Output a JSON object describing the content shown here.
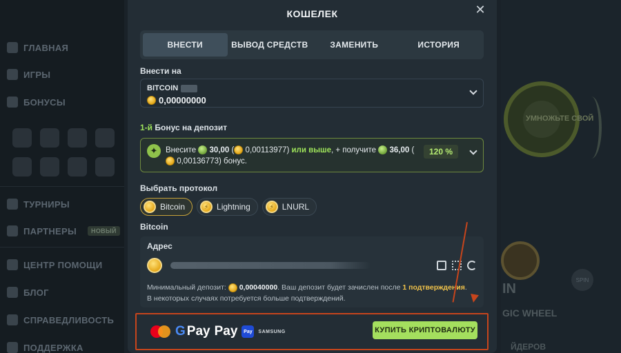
{
  "background_sidebar": {
    "items": [
      {
        "label": "ГЛАВНАЯ",
        "icon": "home-icon"
      },
      {
        "label": "ИГРЫ",
        "icon": "gamepad-icon"
      },
      {
        "label": "БОНУСЫ",
        "icon": "gift-icon"
      },
      {
        "label": "ТУРНИРЫ",
        "icon": "trophy-icon"
      },
      {
        "label": "ПАРТНЕРЫ",
        "icon": "partners-icon",
        "badge": "НОВЫЙ"
      },
      {
        "label": "ЦЕНТР ПОМОЩИ",
        "icon": "help-icon"
      },
      {
        "label": "БЛОГ",
        "icon": "blog-icon"
      },
      {
        "label": "СПРАВЕДЛИВОСТЬ",
        "icon": "fairness-icon"
      },
      {
        "label": "ПОДДЕРЖКА",
        "icon": "support-icon"
      }
    ]
  },
  "background_right": {
    "promo_text": "УМНОЖЬТЕ СВОЙ",
    "wheel_title_fragment": "IN",
    "wheel_subtitle_fragment": "GIC WHEEL",
    "spin_label": "SPIN",
    "leaders_fragment": "ЙДЕРОВ"
  },
  "modal": {
    "title": "КОШЕЛЕК",
    "close_symbol": "✕",
    "tabs": [
      {
        "label": "ВНЕСТИ",
        "active": true
      },
      {
        "label": "ВЫВОД СРЕДСТВ",
        "active": false
      },
      {
        "label": "ЗАМЕНИТЬ",
        "active": false
      },
      {
        "label": "ИСТОРИЯ",
        "active": false
      }
    ],
    "deposit_to_label": "Внести на",
    "currency": {
      "name": "BITCOIN",
      "amount": "0,00000000",
      "icon": "bitcoin-coin-icon"
    },
    "bonus": {
      "heading_accent": "1-й",
      "heading_rest": " Бонус на депозит",
      "text_prefix": "Внесите",
      "deposit_amount": "30,00",
      "deposit_btc": "0,00113977",
      "or_more": "или выше",
      "receive": ", + получите",
      "bonus_amount": "36,00",
      "bonus_btc": "0,00136773",
      "suffix": "бонус.",
      "percent": "120 %"
    },
    "protocol_label": "Выбрать протокол",
    "protocols": [
      {
        "label": "Bitcoin",
        "active": true
      },
      {
        "label": "Lightning",
        "active": false
      },
      {
        "label": "LNURL",
        "active": false
      }
    ],
    "selected_protocol_heading": "Bitcoin",
    "address": {
      "label": "Адрес",
      "note_prefix": "Минимальный депозит:",
      "min_deposit": "0,00040000",
      "note_middle": ". Ваш депозит будет зачислен после",
      "confirmations": "1 подтверждения",
      "note_suffix": ". В некоторых случаях потребуется больше подтверждений."
    },
    "payment": {
      "methods": [
        "mastercard-icon",
        "google-pay-icon",
        "apple-pay-icon",
        "samsung-pay-icon"
      ],
      "gpay_text": "Pay",
      "apay_text": "Pay",
      "samsung_badge": "Pay",
      "samsung_text": "SAMSUNG",
      "buy_button": "КУПИТЬ КРИПТОВАЛЮТУ"
    }
  },
  "colors": {
    "accent_green": "#9ee35a",
    "button_green": "#a4df5e",
    "highlight_border": "#c7451c",
    "modal_bg": "#232d35"
  }
}
